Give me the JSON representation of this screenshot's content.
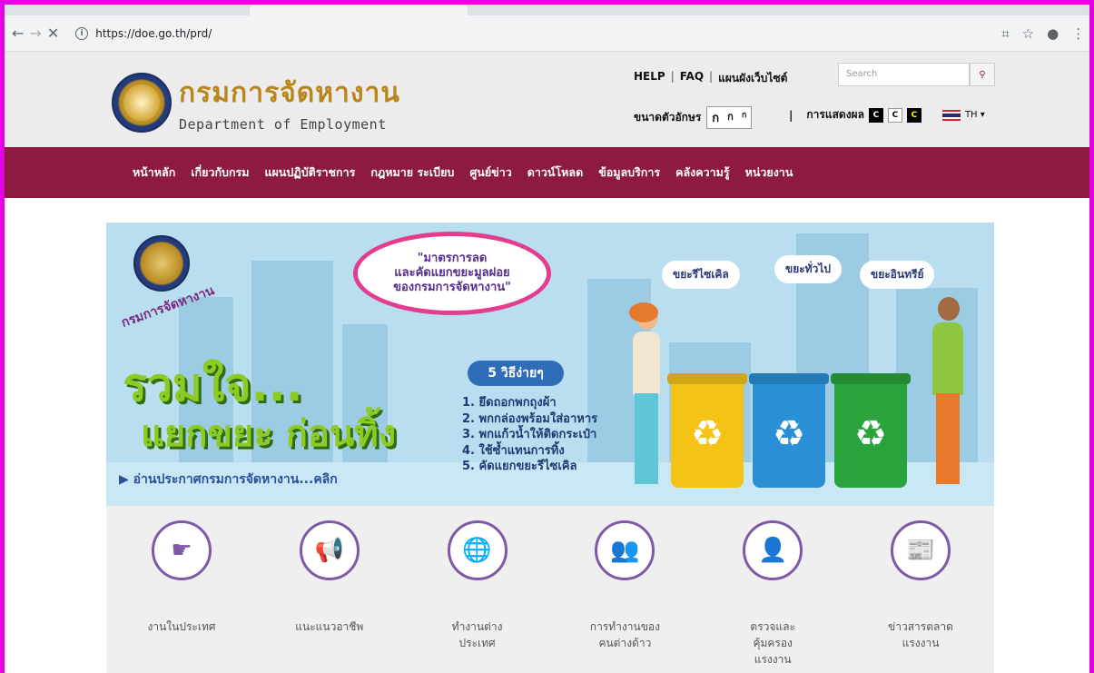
{
  "browser": {
    "url": "https://doe.go.th/prd/",
    "icons": [
      "back-arrow-icon",
      "forward-arrow-icon",
      "stop-icon",
      "info-icon",
      "translate-icon",
      "star-icon",
      "profile-icon",
      "menu-icon"
    ]
  },
  "header": {
    "logo_thai": "กรมการจัดหางาน",
    "logo_english": "Department of Employment",
    "toplinks": [
      "HELP",
      "FAQ",
      "แผนผังเว็บไซต์"
    ],
    "search_placeholder": "Search",
    "fontsize_label": "ขนาดตัวอักษร",
    "fontsize_options": [
      "ก",
      "ก",
      "ก"
    ],
    "display_label": "การแสดงผล",
    "display_options": [
      "C",
      "C",
      "C"
    ],
    "language": "TH ▾",
    "colors": {
      "brand_gold": "#b8861b",
      "nav_bg": "#8d1a3f"
    }
  },
  "nav": {
    "items": [
      "หน้าหลัก",
      "เกี่ยวกับกรม",
      "แผนปฏิบัติราชการ",
      "กฎหมาย ระเบียบ",
      "ศูนย์ข่าว",
      "ดาวน์โหลด",
      "ข้อมูลบริการ",
      "คลังความรู้",
      "หน่วยงาน"
    ]
  },
  "banner": {
    "org_name": "กรมการจัดหางาน",
    "bubble_text": "\"มาตรการลด\nและคัดแยกขยะมูลฝอย\nของกรมการจัดหางาน\"",
    "headline_line1": "รวมใจ...",
    "headline_line2": "แยกขยะ ก่อนทิ้ง",
    "readmore": "▶ อ่านประกาศกรมการจัดหางาน...คลิก",
    "pill": "5 วิธีง่ายๆ",
    "steps": [
      "1. ยึดถอกพกถุงผ้า",
      "2. พกกล่องพร้อมใส่อาหาร",
      "3. พกแก้วน้ำให้ติดกระเป๋า",
      "4. ใช้ซ้ำแทนการทิ้ง",
      "5. คัดแยกขยะรีไซเคิล"
    ],
    "signs": [
      "ขยะรีไซเคิล",
      "ขยะทั่วไป",
      "ขยะอินทรีย์"
    ]
  },
  "services": [
    {
      "label": "งานในประเทศ",
      "icon": "job-seeker-icon"
    },
    {
      "label": "แนะแนวอาชีพ",
      "icon": "megaphone-icon"
    },
    {
      "label": "ทำงานต่าง\nประเทศ",
      "icon": "globe-worker-icon"
    },
    {
      "label": "การทำงานของ\nคนต่างด้าว",
      "icon": "foreign-workers-icon"
    },
    {
      "label": "ตรวจและ\nคุ้มครอง\nแรงงาน",
      "icon": "inspector-icon"
    },
    {
      "label": "ข่าวสารตลาด\nแรงงาน",
      "icon": "jobs-news-icon"
    }
  ]
}
